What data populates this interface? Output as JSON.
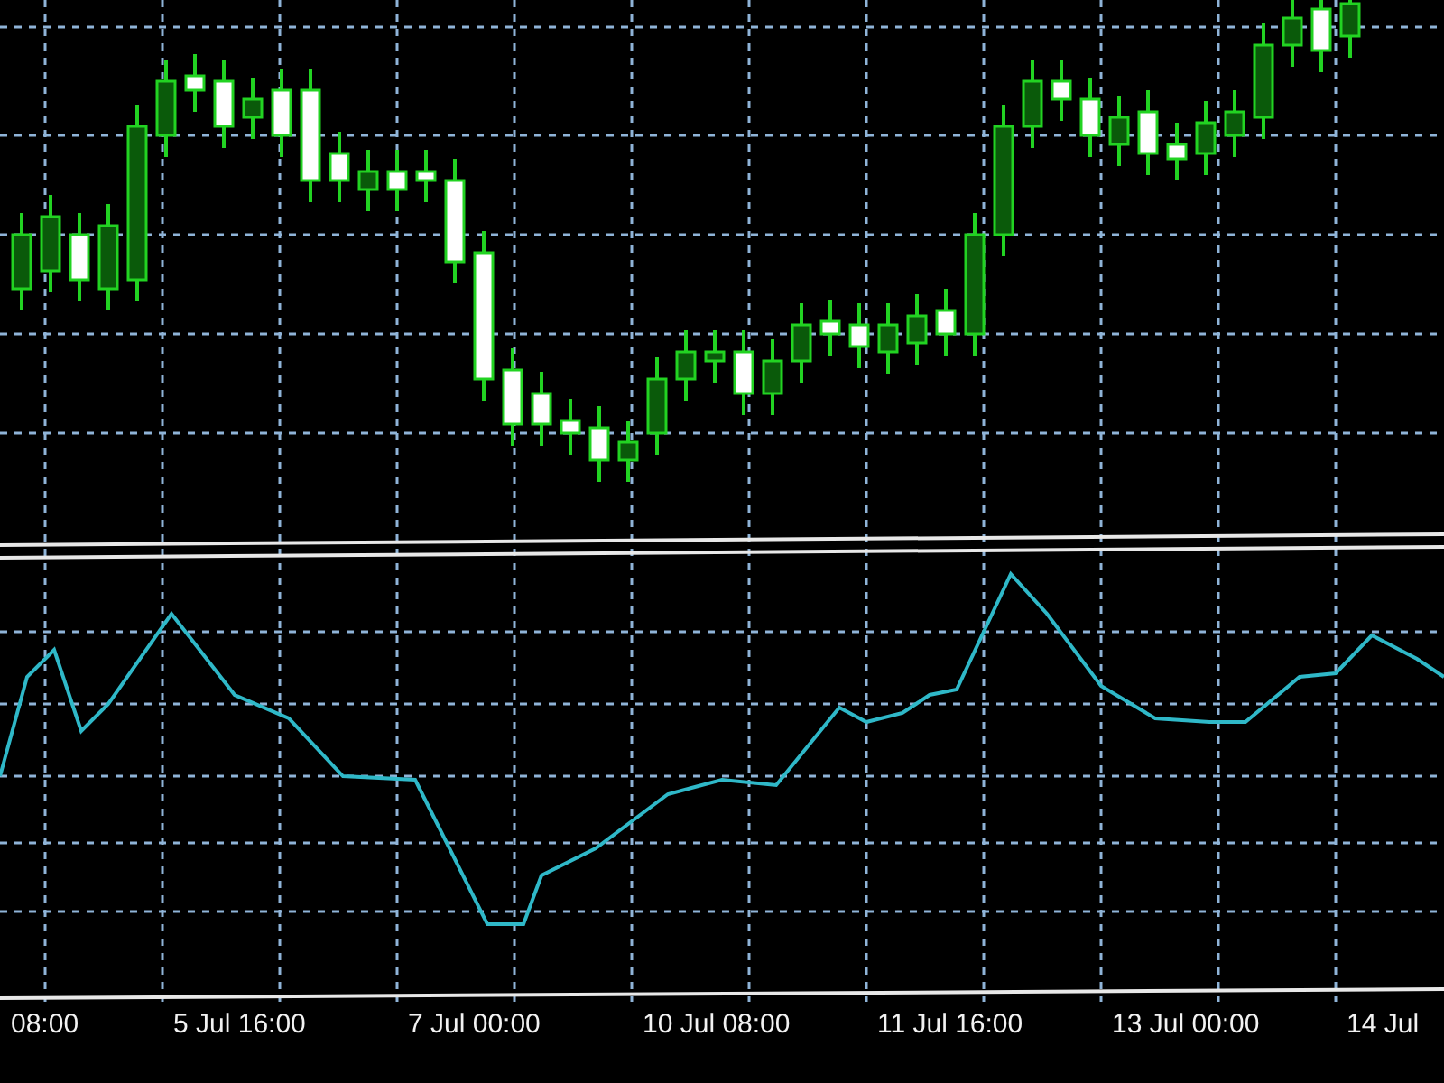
{
  "time_axis": {
    "labels": [
      "08:00",
      "5 Jul 16:00",
      "7 Jul 00:00",
      "10 Jul 08:00",
      "11 Jul 16:00",
      "13 Jul 00:00",
      "14 Jul"
    ]
  }
}
